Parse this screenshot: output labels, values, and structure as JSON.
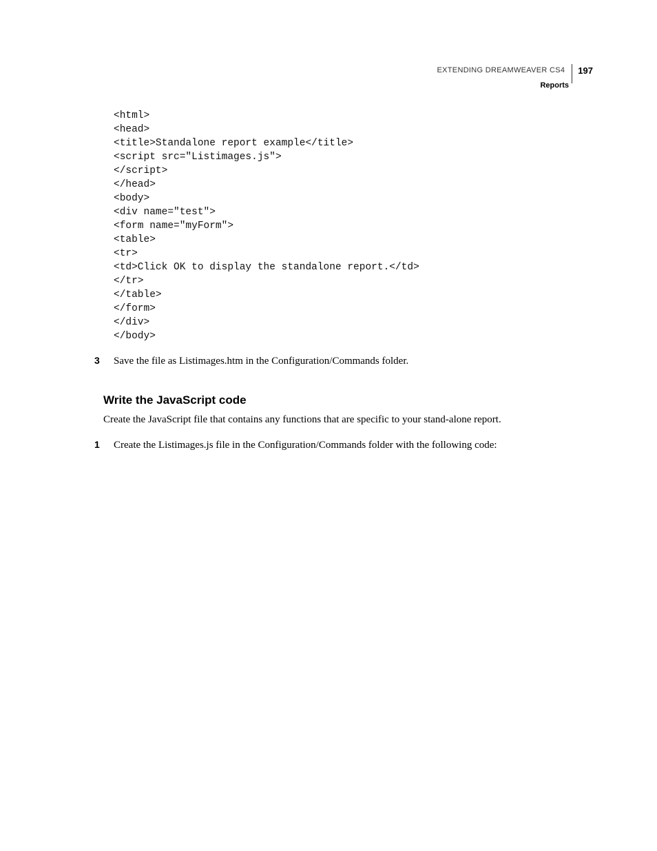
{
  "header": {
    "title": "EXTENDING DREAMWEAVER CS4",
    "page": "197",
    "section": "Reports"
  },
  "code": {
    "lines": [
      "<html>",
      "<head>",
      "<title>Standalone report example</title>",
      "<script src=\"Listimages.js\">",
      "</script>",
      "</head>",
      "<body>",
      "<div name=\"test\">",
      "<form name=\"myForm\">",
      "<table>",
      "<tr>",
      "<td>Click OK to display the standalone report.</td>",
      "</tr>",
      "</table>",
      "</form>",
      "</div>",
      "</body>"
    ]
  },
  "step3": {
    "num": "3",
    "text": "Save the file as Listimages.htm in the Configuration/Commands folder."
  },
  "heading": "Write the JavaScript code",
  "para": "Create the JavaScript file that contains any functions that are specific to your stand-alone report.",
  "step1": {
    "num": "1",
    "text": "Create the Listimages.js file in the Configuration/Commands folder with the following code:"
  }
}
